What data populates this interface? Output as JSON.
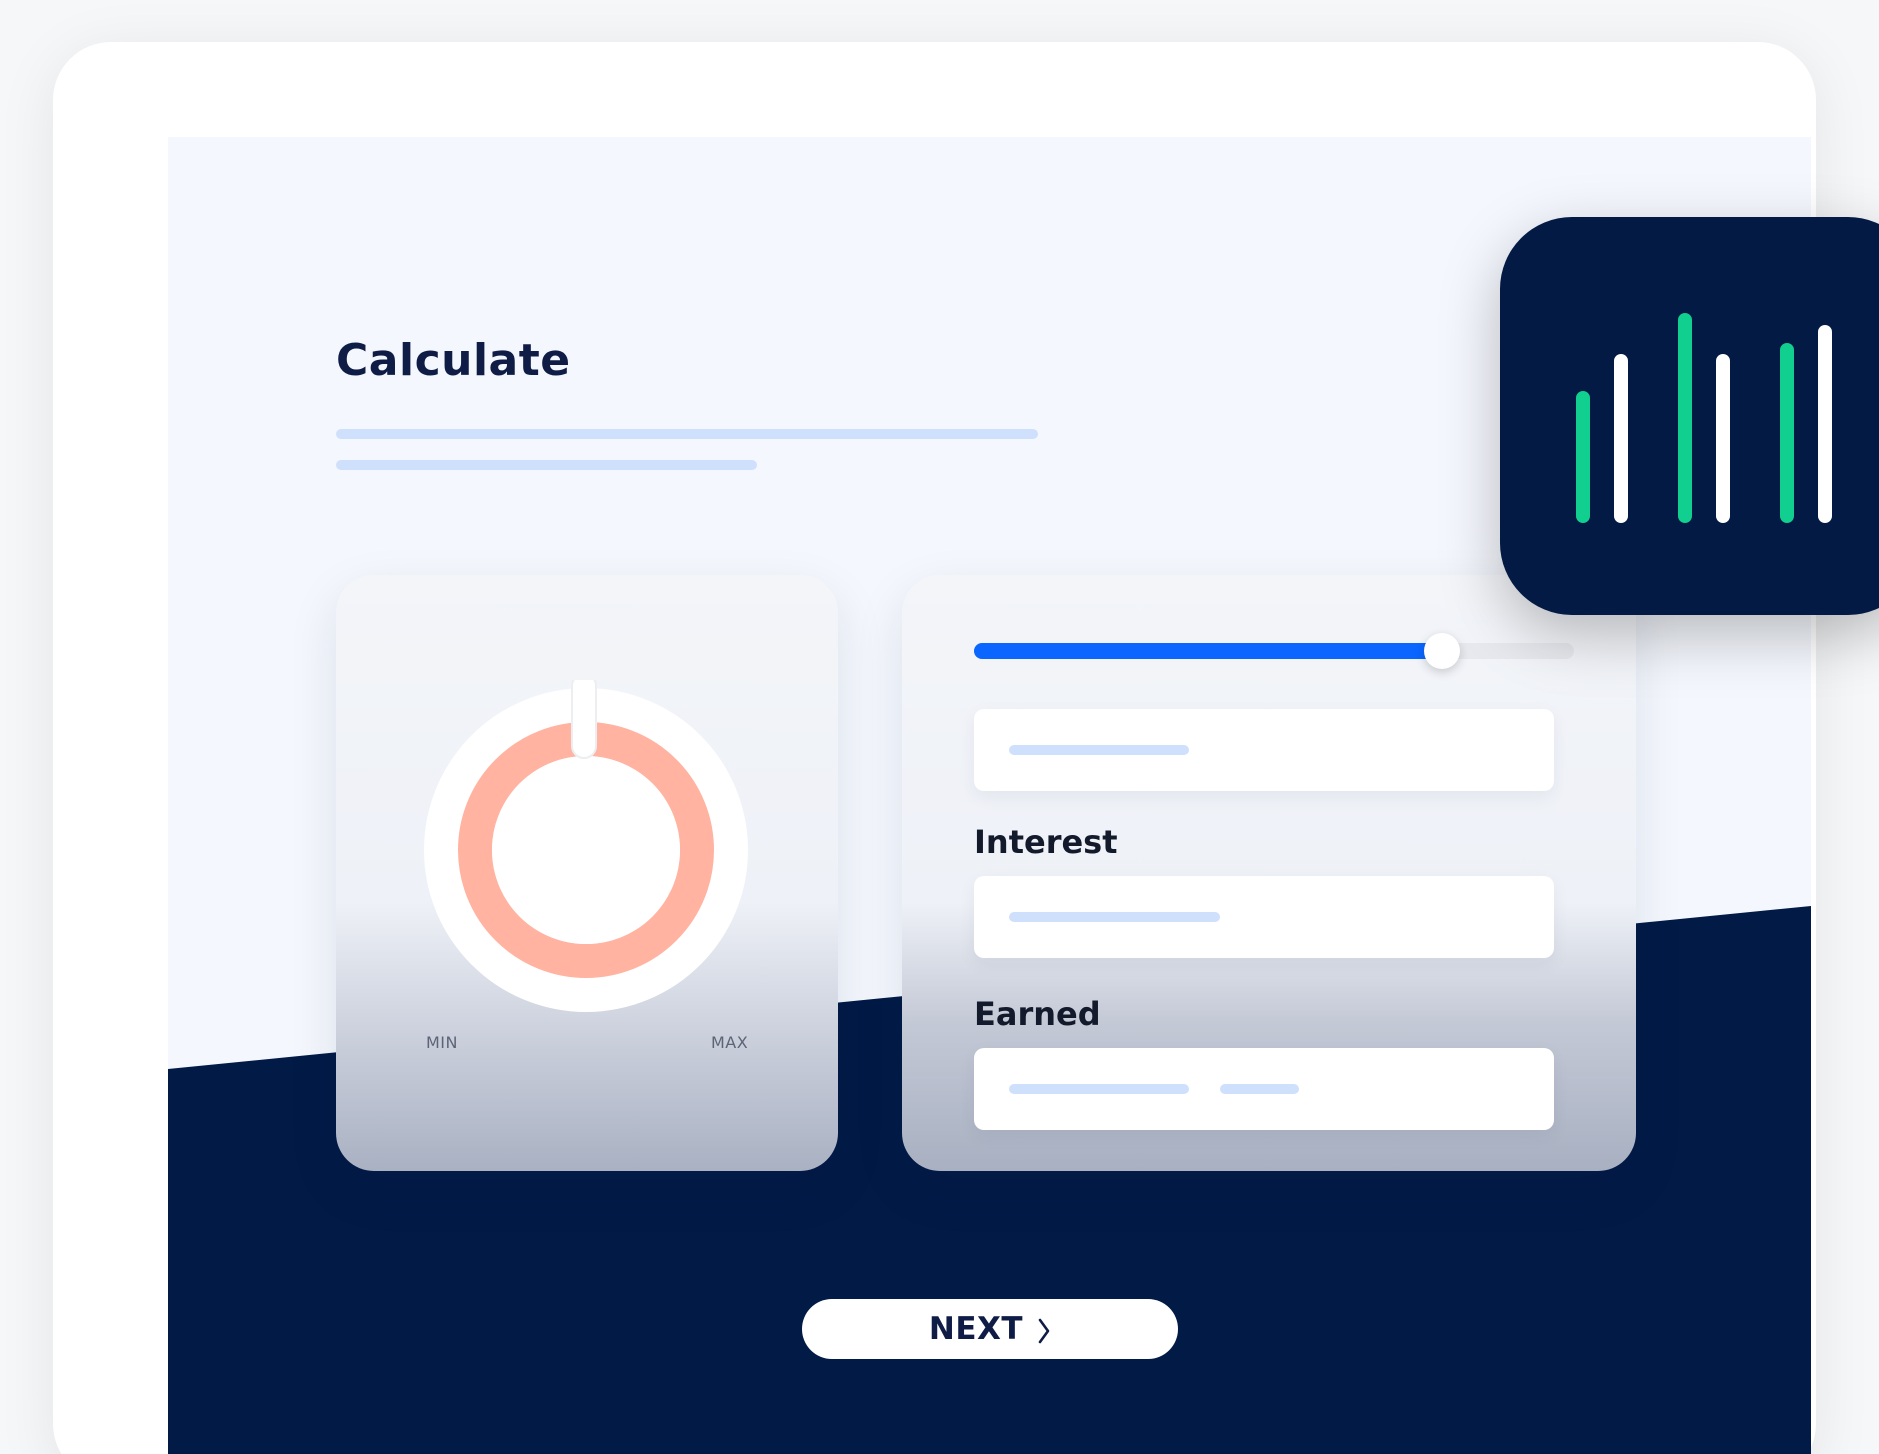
{
  "page": {
    "title": "Calculate"
  },
  "dial": {
    "min_label": "MIN",
    "max_label": "MAX",
    "ring_color": "#ffb3a0"
  },
  "form": {
    "slider_value_fraction": 0.78,
    "interest_label": "Interest",
    "earned_label": "Earned",
    "accent_color": "#0a66ff"
  },
  "actions": {
    "next_label": "NEXT"
  },
  "icons": {
    "bar_chart_icon": "bar-chart-icon",
    "next_chevron": "chevron-right-icon"
  },
  "colors": {
    "navy": "#031a45",
    "green": "#10cf8f",
    "skeleton": "#cfe0fd"
  }
}
